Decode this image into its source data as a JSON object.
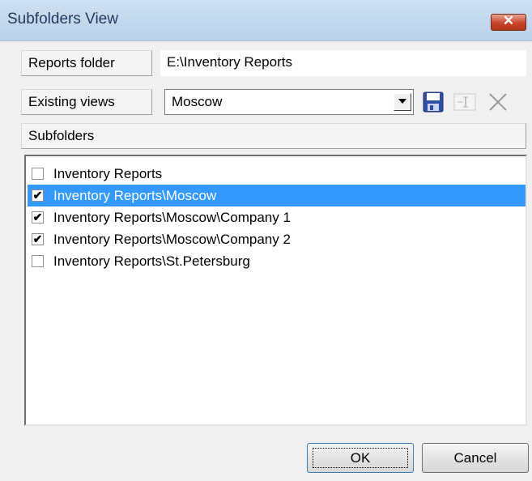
{
  "window": {
    "title": "Subfolders View",
    "close_symbol": "✕"
  },
  "reports_folder": {
    "label": "Reports folder",
    "value": "E:\\Inventory Reports"
  },
  "existing_views": {
    "label": "Existing views",
    "selected": "Moscow"
  },
  "toolbar": {
    "save_icon": "floppy-disk-icon",
    "rename_icon": "rename-icon",
    "delete_icon": "delete-x-icon"
  },
  "subfolders": {
    "label": "Subfolders",
    "items": [
      {
        "label": "Inventory Reports",
        "checked": false,
        "selected": false
      },
      {
        "label": "Inventory Reports\\Moscow",
        "checked": true,
        "selected": true
      },
      {
        "label": "Inventory Reports\\Moscow\\Company 1",
        "checked": true,
        "selected": false
      },
      {
        "label": "Inventory Reports\\Moscow\\Company 2",
        "checked": true,
        "selected": false
      },
      {
        "label": "Inventory Reports\\St.Petersburg",
        "checked": false,
        "selected": false
      }
    ]
  },
  "buttons": {
    "ok": "OK",
    "cancel": "Cancel"
  },
  "colors": {
    "selection": "#3399ff",
    "title_text": "#1e395b"
  }
}
